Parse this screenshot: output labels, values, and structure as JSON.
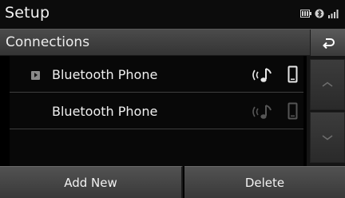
{
  "header": {
    "title": "Setup",
    "status_icons": [
      "battery-icon",
      "bluetooth-icon",
      "signal-icon"
    ]
  },
  "subheader": {
    "title": "Connections",
    "back_icon": "back-arrow-icon"
  },
  "devices": [
    {
      "name": "Bluetooth Phone",
      "selected": true,
      "icons": [
        "audio-streaming-icon",
        "phone-icon"
      ],
      "icons_active": true
    },
    {
      "name": "Bluetooth Phone",
      "selected": false,
      "icons": [
        "audio-streaming-icon",
        "phone-icon"
      ],
      "icons_active": false
    }
  ],
  "scroll": {
    "up_icon": "chevron-up-icon",
    "down_icon": "chevron-down-icon"
  },
  "footer": {
    "add_label": "Add New",
    "delete_label": "Delete"
  },
  "colors": {
    "background": "#000000",
    "bar": "#444444",
    "text": "#f0f0f0",
    "icon_active": "#e6e6e6",
    "icon_inactive": "#5a5a5a"
  }
}
